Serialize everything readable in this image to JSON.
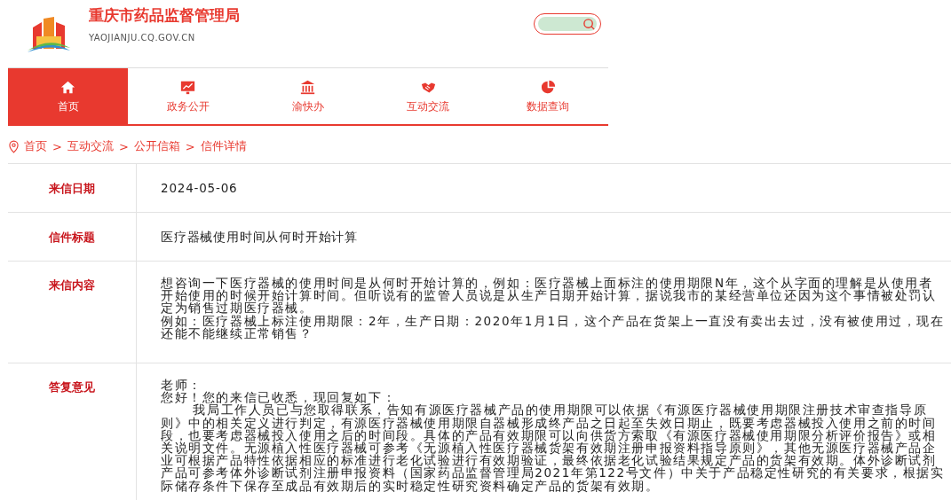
{
  "header": {
    "title": "重庆市药品监督管理局",
    "domain": "YAOJIANJU.CQ.GOV.CN"
  },
  "nav": [
    {
      "label": "首页",
      "selected": true
    },
    {
      "label": "政务公开",
      "selected": false
    },
    {
      "label": "渝快办",
      "selected": false
    },
    {
      "label": "互动交流",
      "selected": false
    },
    {
      "label": "数据查询",
      "selected": false
    }
  ],
  "breadcrumb": {
    "separator": ">",
    "items": [
      "首页",
      "互动交流",
      "公开信箱",
      "信件详情"
    ]
  },
  "rows": [
    {
      "label": "来信日期",
      "paragraphs": [
        "2024-05-06"
      ]
    },
    {
      "label": "信件标题",
      "paragraphs": [
        "医疗器械使用时间从何时开始计算"
      ]
    },
    {
      "label": "来信内容",
      "paragraphs": [
        "想咨询一下医疗器械的使用时间是从何时开始计算的，例如：医疗器械上面标注的使用期限N年，这个从字面的理解是从使用者开始使用的时候开始计算时间。但听说有的监管人员说是从生产日期开始计算，据说我市的某经营单位还因为这个事情被处罚认定为销售过期医疗器械。",
        "例如：医疗器械上标注使用期限：2年，生产日期：2020年1月1日，这个产品在货架上一直没有卖出去过，没有被使用过，现在还能不能继续正常销售？"
      ]
    },
    {
      "label": "答复意见",
      "paragraphs": [
        "老师：",
        "您好！您的来信已收悉，现回复如下：",
        "我局工作人员已与您取得联系，告知有源医疗器械产品的使用期限可以依据《有源医疗器械使用期限注册技术审查指导原则》中的相关定义进行判定，有源医疗器械使用期限自器械形成终产品之日起至失效日期止，既要考虑器械投入使用之前的时间段，也要考虑器械投入使用之后的时间段。具体的产品有效期限可以向供货方索取《有源医疗器械使用期限分析评价报告》或相关说明文件。无源植入性医疗器械可参考《无源植入性医疗器械货架有效期注册申报资料指导原则》，其他无源医疗器械产品企业可根据产品特性依据相应的标准进行老化试验进行有效期验证，最终依据老化试验结果规定产品的货架有效期。体外诊断试剂产品可参考体外诊断试剂注册申报资料（国家药品监督管理局2021年第122号文件）中关于产品稳定性研究的有关要求，根据实际储存条件下保存至成品有效期后的实时稳定性研究资料确定产品的货架有效期。"
      ]
    }
  ]
}
